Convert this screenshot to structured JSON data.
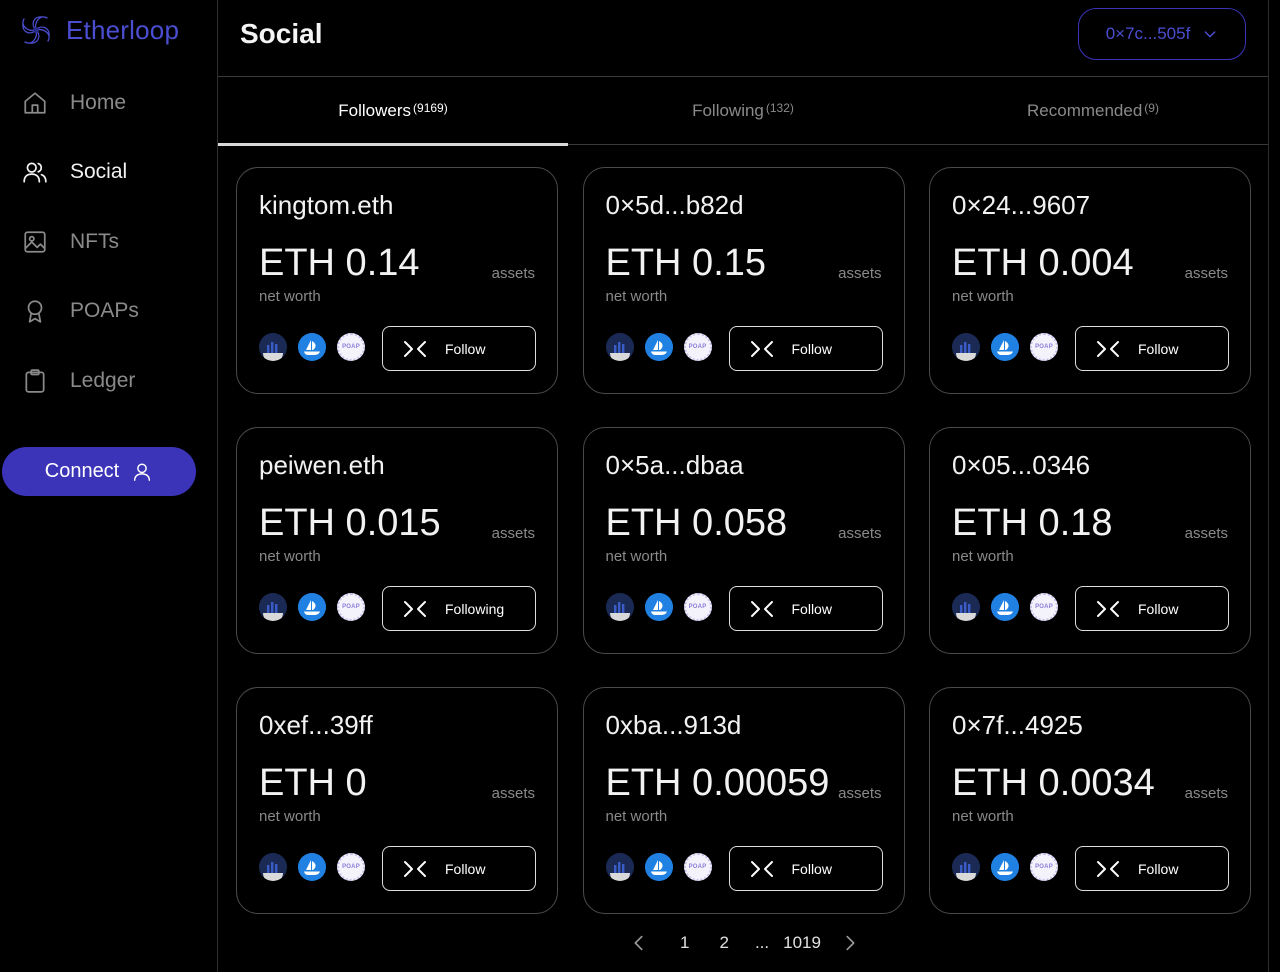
{
  "app": {
    "name": "Etherloop",
    "brand_color": "#3b34b8"
  },
  "sidebar": {
    "items": [
      {
        "label": "Home",
        "icon": "home-icon"
      },
      {
        "label": "Social",
        "icon": "users-icon",
        "active": true
      },
      {
        "label": "NFTs",
        "icon": "image-icon"
      },
      {
        "label": "POAPs",
        "icon": "award-icon"
      },
      {
        "label": "Ledger",
        "icon": "clipboard-icon"
      }
    ],
    "connect_label": "Connect"
  },
  "header": {
    "title": "Social",
    "wallet": "0×7c...505f"
  },
  "tabs": [
    {
      "label": "Followers",
      "count": "(9169)",
      "active": true
    },
    {
      "label": "Following",
      "count": "(132)"
    },
    {
      "label": "Recommended",
      "count": "(9)"
    }
  ],
  "card_labels": {
    "assets": "assets",
    "net_worth": "net worth",
    "poap_badge": "POAP"
  },
  "cards": [
    {
      "name": "kingtom.eth",
      "worth": "ETH 0.14",
      "action": "Follow"
    },
    {
      "name": "0×5d...b82d",
      "worth": "ETH 0.15",
      "action": "Follow"
    },
    {
      "name": "0×24...9607",
      "worth": "ETH 0.004",
      "action": "Follow"
    },
    {
      "name": "peiwen.eth",
      "worth": "ETH 0.015",
      "action": "Following"
    },
    {
      "name": "0×5a...dbaa",
      "worth": "ETH 0.058",
      "action": "Follow"
    },
    {
      "name": "0×05...0346",
      "worth": "ETH 0.18",
      "action": "Follow"
    },
    {
      "name": "0xef...39ff",
      "worth": "ETH 0",
      "action": "Follow"
    },
    {
      "name": "0xba...913d",
      "worth": "ETH 0.00059",
      "action": "Follow"
    },
    {
      "name": "0×7f...4925",
      "worth": "ETH 0.0034",
      "action": "Follow"
    }
  ],
  "pagination": {
    "pages": [
      "1",
      "2",
      "...",
      "1019"
    ]
  }
}
